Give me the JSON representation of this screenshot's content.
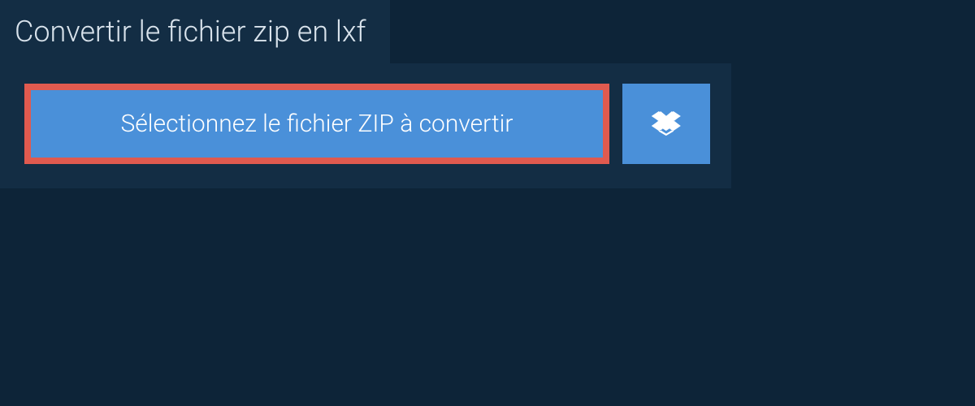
{
  "header": {
    "title": "Convertir le fichier zip en lxf"
  },
  "actions": {
    "select_file_label": "Sélectionnez le fichier ZIP à convertir",
    "dropbox_icon_name": "dropbox-icon"
  },
  "colors": {
    "background": "#0d2438",
    "panel": "#132d44",
    "button_primary": "#4a90d9",
    "highlight_border": "#e05a4f",
    "text_light": "#d9e3ec",
    "text_white": "#ffffff"
  }
}
